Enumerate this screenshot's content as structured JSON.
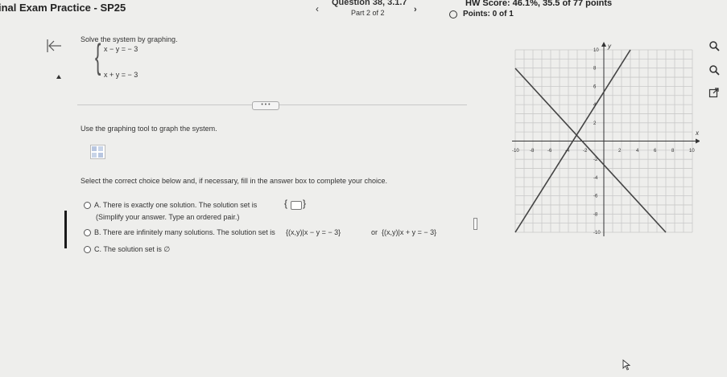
{
  "header": {
    "exam_title": "inal Exam Practice - SP25",
    "question_label": "Question 38, 3.1.7",
    "part_label": "Part 2 of 2",
    "hw_score": "HW Score: 46.1%, 35.5 of 77 points",
    "points": "Points: 0 of 1",
    "prev_icon": "chevron-left-icon",
    "next_icon": "chevron-right-icon"
  },
  "problem": {
    "instruction": "Solve the system by graphing.",
    "equation1": "x − y = − 3",
    "equation2": "x + y = − 3",
    "more_label": "• • •",
    "use_tool": "Use the graphing tool to graph the system.",
    "select_instruction": "Select the correct choice below and, if necessary, fill in the answer box to complete your choice."
  },
  "choices": {
    "a_text": "A.  There is exactly one solution. The solution set is",
    "a_note": "(Simplify your answer. Type an ordered pair.)",
    "b_text": "B.  There are infinitely many solutions. The solution set is",
    "b_set1": "{(x,y)|x − y = − 3}",
    "b_or": "or",
    "b_set2": "{(x,y)|x + y = − 3}",
    "c_text": "C.  The solution set is ∅"
  },
  "graph": {
    "y_axis_label": "y",
    "x_axis_label": "x",
    "x_ticks": [
      "-10",
      "-8",
      "-6",
      "-4",
      "-2",
      "2",
      "4",
      "6",
      "8",
      "10"
    ],
    "y_ticks": [
      "10",
      "8",
      "6",
      "4",
      "2",
      "-2",
      "-4",
      "-6",
      "-8",
      "-10"
    ]
  },
  "side_tools": {
    "zoom_in_icon": "zoom-in-icon",
    "zoom_out_icon": "zoom-out-icon",
    "popout_icon": "external-link-icon"
  },
  "colors": {
    "line": "#444444",
    "grid": "#c9c9c9",
    "accent": "#2a5db0"
  }
}
